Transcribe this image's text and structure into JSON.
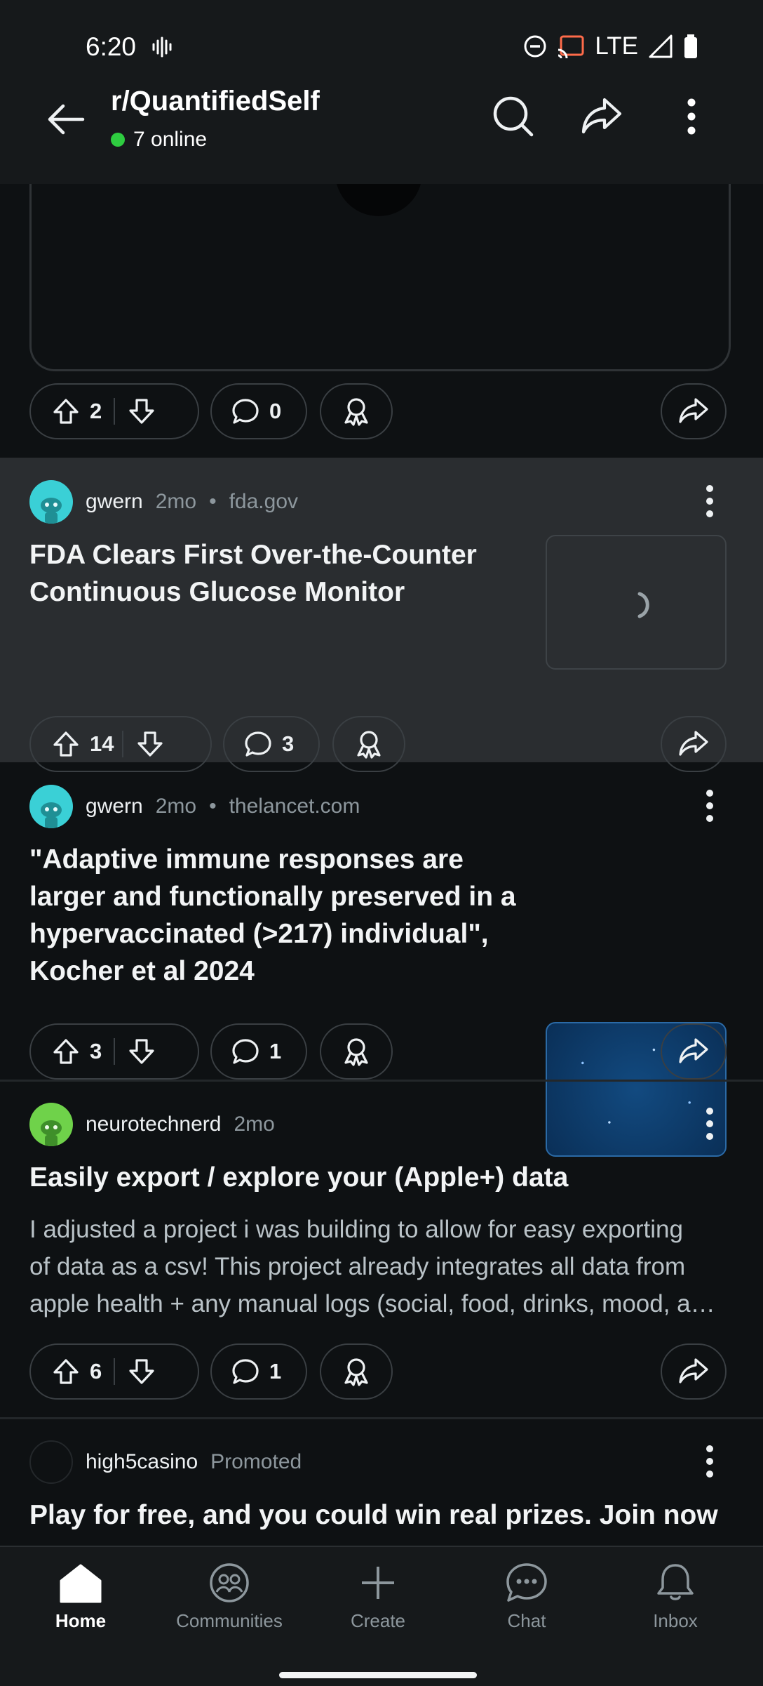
{
  "status_bar": {
    "time": "6:20",
    "network": "LTE"
  },
  "header": {
    "subreddit": "r/QuantifiedSelf",
    "online": "7 online"
  },
  "posts": [
    {
      "upvotes": "2",
      "comments": "0"
    },
    {
      "author": "gwern",
      "age": "2mo",
      "separator": "•",
      "domain": "fda.gov",
      "title_lines": [
        "FDA Clears First Over-the-Counter",
        "Continuous Glucose Monitor"
      ],
      "upvotes": "14",
      "comments": "3",
      "highlighted": true
    },
    {
      "author": "gwern",
      "age": "2mo",
      "separator": "•",
      "domain": "thelancet.com",
      "title_lines": [
        "\"Adaptive immune responses are",
        "larger and functionally preserved in a",
        "hypervaccinated (>217) individual\",",
        "Kocher et al 2024"
      ],
      "upvotes": "3",
      "comments": "1"
    },
    {
      "author": "neurotechnerd",
      "age": "2mo",
      "title_lines": [
        "Easily export / explore your (Apple+) data"
      ],
      "body_lines": [
        "I adjusted a project i was building to allow for easy exporting",
        "of data as a csv! This project already integrates all data from",
        "apple health + any manual logs (social, food, drinks, mood, a…"
      ],
      "upvotes": "6",
      "comments": "1"
    },
    {
      "author": "high5casino",
      "label": "Promoted",
      "title_lines": [
        "Play for free, and you could win real prizes. Join now"
      ]
    }
  ],
  "bottom_nav": [
    {
      "label": "Home",
      "icon": "home-icon",
      "active": true
    },
    {
      "label": "Communities",
      "icon": "communities-icon"
    },
    {
      "label": "Create",
      "icon": "plus-icon"
    },
    {
      "label": "Chat",
      "icon": "chat-icon"
    },
    {
      "label": "Inbox",
      "icon": "bell-icon"
    }
  ],
  "colors": {
    "background": "#0e1113",
    "highlight": "#2a2d30",
    "online_dot": "#2ecc40",
    "avatar_teal": "#3ad0d6",
    "avatar_green": "#6fd24a"
  }
}
